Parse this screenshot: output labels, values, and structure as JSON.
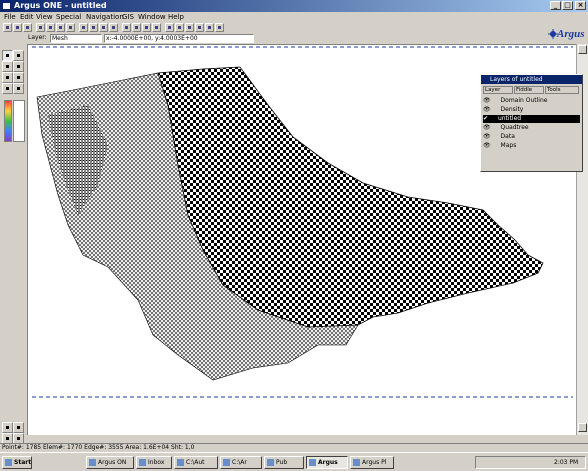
{
  "window": {
    "title": "Argus ONE - untitled",
    "min": "_",
    "max": "□",
    "close": "×"
  },
  "menu": [
    "File",
    "Edit",
    "View",
    "Special",
    "Navigation",
    "GIS",
    "Window",
    "Help"
  ],
  "toolbar2": {
    "layer_label": "Layer:",
    "layer_value": "Mesh",
    "coords": "x:-4.0000E+00, y:4.0003E+00"
  },
  "logo": {
    "text": "Argus",
    "accent": "#1b3aa0"
  },
  "layers_palette": {
    "title": "Layers of untitled",
    "tabs": [
      "Layer",
      "Fiddle",
      "Tools"
    ],
    "rows": [
      {
        "label": "Domain Outline"
      },
      {
        "label": "Density"
      },
      {
        "label": "untitled"
      },
      {
        "label": "Quadtree"
      },
      {
        "label": "Data"
      },
      {
        "label": "Maps"
      }
    ],
    "selected_index": 2
  },
  "status": "Point#: 1785  Elem#: 1770  Edge#: 3555  Area: 1.6E+04  Sht: 1,0",
  "taskbar": {
    "start": "Start",
    "tasks": [
      "Argus ON",
      "Inbox",
      "C:\\Aut",
      "C:\\Ar",
      "Pub",
      "Argus",
      "Argus Pl"
    ],
    "active_index": 5,
    "clock": "2:03 PM"
  },
  "colors": {
    "titlebar": "#0a246a",
    "dash_line": "#1b3aa0",
    "mesh": "#000000"
  },
  "icons": [
    "arrow-icon",
    "zoom-icon",
    "pencil-icon",
    "node-icon",
    "element-icon",
    "eye-icon",
    "layer-icon"
  ]
}
